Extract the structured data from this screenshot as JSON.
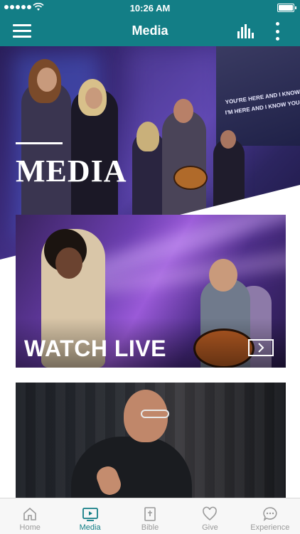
{
  "status_bar": {
    "time": "10:26 AM"
  },
  "nav": {
    "title": "Media"
  },
  "hero": {
    "title": "MEDIA",
    "lyric_line1": "YOU'RE HERE AND I KNOW YOU ARE MOVING",
    "lyric_line2": "I'M HERE AND I KNOW YOU WILL FILL ME"
  },
  "cards": [
    {
      "title": "WATCH LIVE"
    }
  ],
  "tabs": [
    {
      "label": "Home",
      "icon": "home-icon"
    },
    {
      "label": "Media",
      "icon": "tv-play-icon",
      "active": true
    },
    {
      "label": "Bible",
      "icon": "bible-icon"
    },
    {
      "label": "Give",
      "icon": "heart-icon"
    },
    {
      "label": "Experience",
      "icon": "chat-bubble-icon"
    }
  ],
  "colors": {
    "brand": "#137e86",
    "tab_inactive": "#9a9a9a"
  }
}
